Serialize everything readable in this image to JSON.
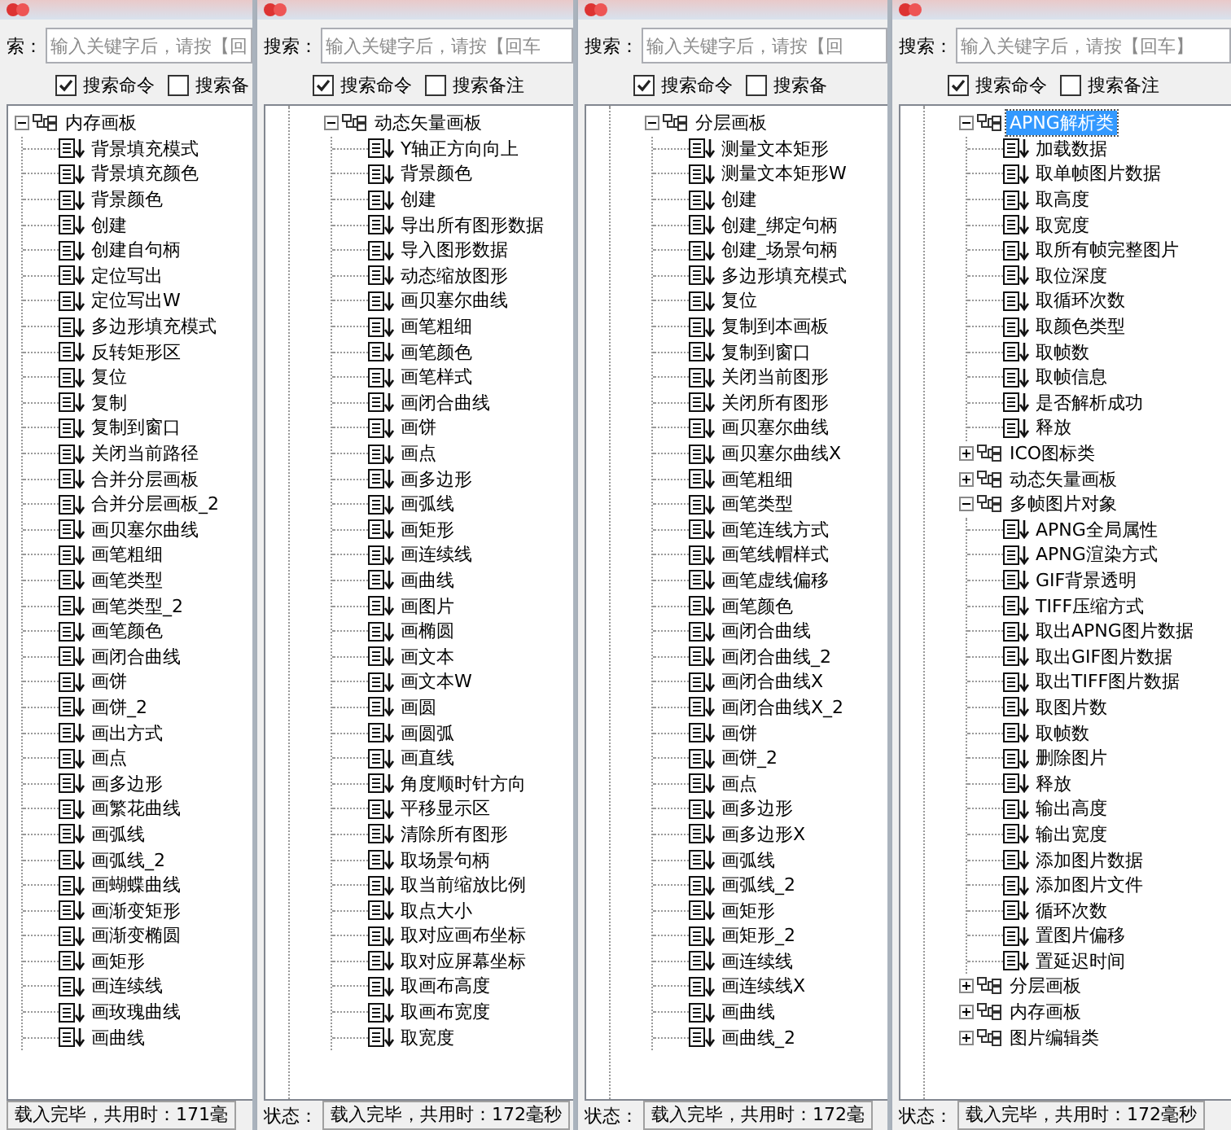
{
  "windows": [
    {
      "search_label": "索：",
      "search_placeholder": "输入关键字后，请按【回",
      "options": [
        {
          "label": "搜索命令",
          "checked": true
        },
        {
          "label": "搜索备",
          "checked": false
        }
      ],
      "tree": [
        {
          "label": "内存画板",
          "expanded": true,
          "selected": false,
          "children": [
            {
              "label": "背景填充模式"
            },
            {
              "label": "背景填充颜色"
            },
            {
              "label": "背景颜色"
            },
            {
              "label": "创建"
            },
            {
              "label": "创建自句柄"
            },
            {
              "label": "定位写出"
            },
            {
              "label": "定位写出W"
            },
            {
              "label": "多边形填充模式"
            },
            {
              "label": "反转矩形区"
            },
            {
              "label": "复位"
            },
            {
              "label": "复制"
            },
            {
              "label": "复制到窗口"
            },
            {
              "label": "关闭当前路径"
            },
            {
              "label": "合并分层画板"
            },
            {
              "label": "合并分层画板_2"
            },
            {
              "label": "画贝塞尔曲线"
            },
            {
              "label": "画笔粗细"
            },
            {
              "label": "画笔类型"
            },
            {
              "label": "画笔类型_2"
            },
            {
              "label": "画笔颜色"
            },
            {
              "label": "画闭合曲线"
            },
            {
              "label": "画饼"
            },
            {
              "label": "画饼_2"
            },
            {
              "label": "画出方式"
            },
            {
              "label": "画点"
            },
            {
              "label": "画多边形"
            },
            {
              "label": "画繁花曲线"
            },
            {
              "label": "画弧线"
            },
            {
              "label": "画弧线_2"
            },
            {
              "label": "画蝴蝶曲线"
            },
            {
              "label": "画渐变矩形"
            },
            {
              "label": "画渐变椭圆"
            },
            {
              "label": "画矩形"
            },
            {
              "label": "画连续线"
            },
            {
              "label": "画玫瑰曲线"
            },
            {
              "label": "画曲线"
            }
          ]
        }
      ],
      "status_text": "载入完毕，共用时：171毫"
    },
    {
      "search_label": "搜索：",
      "search_placeholder": "输入关键字后，请按【回车",
      "options": [
        {
          "label": "搜索命令",
          "checked": true
        },
        {
          "label": "搜索备注",
          "checked": false
        }
      ],
      "tree": [
        {
          "label": "动态矢量画板",
          "expanded": true,
          "selected": false,
          "children": [
            {
              "label": "Y轴正方向向上"
            },
            {
              "label": "背景颜色"
            },
            {
              "label": "创建"
            },
            {
              "label": "导出所有图形数据"
            },
            {
              "label": "导入图形数据"
            },
            {
              "label": "动态缩放图形"
            },
            {
              "label": "画贝塞尔曲线"
            },
            {
              "label": "画笔粗细"
            },
            {
              "label": "画笔颜色"
            },
            {
              "label": "画笔样式"
            },
            {
              "label": "画闭合曲线"
            },
            {
              "label": "画饼"
            },
            {
              "label": "画点"
            },
            {
              "label": "画多边形"
            },
            {
              "label": "画弧线"
            },
            {
              "label": "画矩形"
            },
            {
              "label": "画连续线"
            },
            {
              "label": "画曲线"
            },
            {
              "label": "画图片"
            },
            {
              "label": "画椭圆"
            },
            {
              "label": "画文本"
            },
            {
              "label": "画文本W"
            },
            {
              "label": "画圆"
            },
            {
              "label": "画圆弧"
            },
            {
              "label": "画直线"
            },
            {
              "label": "角度顺时针方向"
            },
            {
              "label": "平移显示区"
            },
            {
              "label": "清除所有图形"
            },
            {
              "label": "取场景句柄"
            },
            {
              "label": "取当前缩放比例"
            },
            {
              "label": "取点大小"
            },
            {
              "label": "取对应画布坐标"
            },
            {
              "label": "取对应屏幕坐标"
            },
            {
              "label": "取画布高度"
            },
            {
              "label": "取画布宽度"
            },
            {
              "label": "取宽度"
            }
          ]
        }
      ],
      "status_label": "状态：",
      "status_text": "载入完毕，共用时：172毫秒"
    },
    {
      "search_label": "搜索：",
      "search_placeholder": "输入关键字后，请按【回",
      "options": [
        {
          "label": "搜索命令",
          "checked": true
        },
        {
          "label": "搜索备",
          "checked": false
        }
      ],
      "tree": [
        {
          "label": "分层画板",
          "expanded": true,
          "selected": false,
          "children": [
            {
              "label": "测量文本矩形"
            },
            {
              "label": "测量文本矩形W"
            },
            {
              "label": "创建"
            },
            {
              "label": "创建_绑定句柄"
            },
            {
              "label": "创建_场景句柄"
            },
            {
              "label": "多边形填充模式"
            },
            {
              "label": "复位"
            },
            {
              "label": "复制到本画板"
            },
            {
              "label": "复制到窗口"
            },
            {
              "label": "关闭当前图形"
            },
            {
              "label": "关闭所有图形"
            },
            {
              "label": "画贝塞尔曲线"
            },
            {
              "label": "画贝塞尔曲线X"
            },
            {
              "label": "画笔粗细"
            },
            {
              "label": "画笔类型"
            },
            {
              "label": "画笔连线方式"
            },
            {
              "label": "画笔线帽样式"
            },
            {
              "label": "画笔虚线偏移"
            },
            {
              "label": "画笔颜色"
            },
            {
              "label": "画闭合曲线"
            },
            {
              "label": "画闭合曲线_2"
            },
            {
              "label": "画闭合曲线X"
            },
            {
              "label": "画闭合曲线X_2"
            },
            {
              "label": "画饼"
            },
            {
              "label": "画饼_2"
            },
            {
              "label": "画点"
            },
            {
              "label": "画多边形"
            },
            {
              "label": "画多边形X"
            },
            {
              "label": "画弧线"
            },
            {
              "label": "画弧线_2"
            },
            {
              "label": "画矩形"
            },
            {
              "label": "画矩形_2"
            },
            {
              "label": "画连续线"
            },
            {
              "label": "画连续线X"
            },
            {
              "label": "画曲线"
            },
            {
              "label": "画曲线_2"
            }
          ]
        }
      ],
      "status_label": "状态：",
      "status_text": "载入完毕，共用时：172毫"
    },
    {
      "search_label": "搜索：",
      "search_placeholder": "输入关键字后，请按【回车】",
      "options": [
        {
          "label": "搜索命令",
          "checked": true
        },
        {
          "label": "搜索备注",
          "checked": false
        }
      ],
      "tree": [
        {
          "label": "APNG解析类",
          "expanded": true,
          "selected": true,
          "children": [
            {
              "label": "加载数据"
            },
            {
              "label": "取单帧图片数据"
            },
            {
              "label": "取高度"
            },
            {
              "label": "取宽度"
            },
            {
              "label": "取所有帧完整图片"
            },
            {
              "label": "取位深度"
            },
            {
              "label": "取循环次数"
            },
            {
              "label": "取颜色类型"
            },
            {
              "label": "取帧数"
            },
            {
              "label": "取帧信息"
            },
            {
              "label": "是否解析成功"
            },
            {
              "label": "释放"
            }
          ]
        },
        {
          "label": "ICO图标类",
          "expanded": false,
          "selected": false
        },
        {
          "label": "动态矢量画板",
          "expanded": false,
          "selected": false
        },
        {
          "label": "多帧图片对象",
          "expanded": true,
          "selected": false,
          "children": [
            {
              "label": "APNG全局属性"
            },
            {
              "label": "APNG渲染方式"
            },
            {
              "label": "GIF背景透明"
            },
            {
              "label": "TIFF压缩方式"
            },
            {
              "label": "取出APNG图片数据"
            },
            {
              "label": "取出GIF图片数据"
            },
            {
              "label": "取出TIFF图片数据"
            },
            {
              "label": "取图片数"
            },
            {
              "label": "取帧数"
            },
            {
              "label": "删除图片"
            },
            {
              "label": "释放"
            },
            {
              "label": "输出高度"
            },
            {
              "label": "输出宽度"
            },
            {
              "label": "添加图片数据"
            },
            {
              "label": "添加图片文件"
            },
            {
              "label": "循环次数"
            },
            {
              "label": "置图片偏移"
            },
            {
              "label": "置延迟时间"
            }
          ]
        },
        {
          "label": "分层画板",
          "expanded": false,
          "selected": false
        },
        {
          "label": "内存画板",
          "expanded": false,
          "selected": false
        },
        {
          "label": "图片编辑类",
          "expanded": false,
          "selected": false
        }
      ],
      "status_label": "状态：",
      "status_text": "载入完毕，共用时：172毫秒"
    }
  ]
}
